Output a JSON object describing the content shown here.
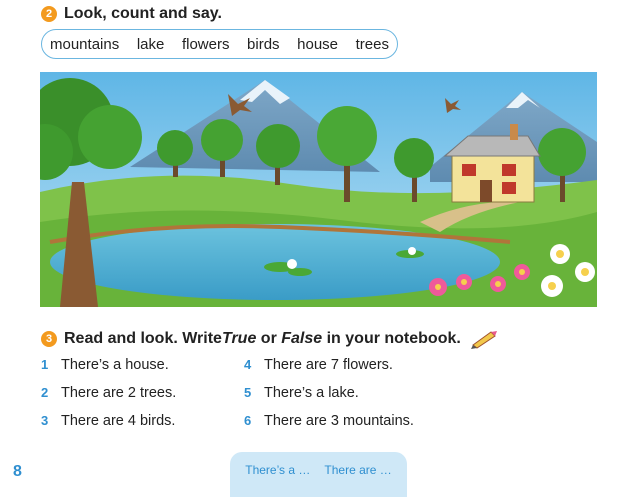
{
  "exercise2": {
    "number": "2",
    "title": "Look, count and say.",
    "words": [
      "mountains",
      "lake",
      "flowers",
      "birds",
      "house",
      "trees"
    ]
  },
  "exercise3": {
    "number": "3",
    "title_pre": "Read and look. Write ",
    "true_word": "True",
    "or_word": " or ",
    "false_word": "False",
    "title_post": " in your notebook.",
    "left": [
      {
        "n": "1",
        "text": "There’s a house."
      },
      {
        "n": "2",
        "text": "There are 2 trees."
      },
      {
        "n": "3",
        "text": "There are 4 birds."
      }
    ],
    "right": [
      {
        "n": "4",
        "text": "There are 7 flowers."
      },
      {
        "n": "5",
        "text": "There’s a lake."
      },
      {
        "n": "6",
        "text": "There are 3 mountains."
      }
    ]
  },
  "footer": {
    "page_number": "8",
    "hint_1": "There’s a …",
    "hint_2": "There are …"
  },
  "colors": {
    "accent_orange": "#f39a1e",
    "accent_blue": "#2f8fd0",
    "box_border": "#6bb6e0",
    "hint_bg": "#cfe8f7"
  },
  "icons": [
    "pencil-icon"
  ]
}
